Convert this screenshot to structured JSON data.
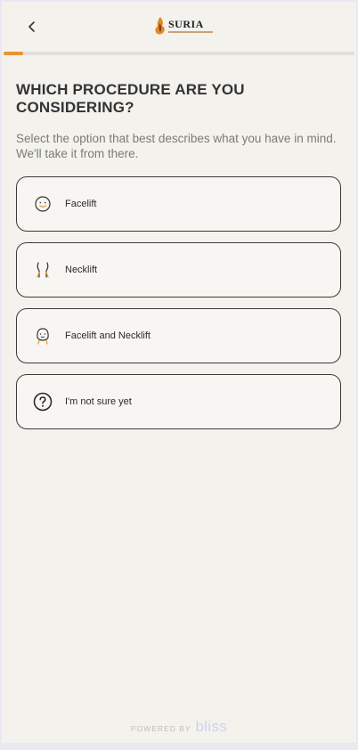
{
  "header": {
    "back_icon": "chevron-left-icon",
    "logo_text": "SURIA",
    "logo_icon": "suria-flame-logo-icon"
  },
  "progress": {
    "fraction": 0.055,
    "color": "#e8942f"
  },
  "question": {
    "title": "WHICH PROCEDURE ARE YOU CONSIDERING?",
    "subtitle": "Select the option that best describes what you have in mind. We'll take it from there."
  },
  "options": [
    {
      "label": "Facelift",
      "icon": "face-icon"
    },
    {
      "label": "Necklift",
      "icon": "neck-icon"
    },
    {
      "label": "Facelift and Necklift",
      "icon": "face-neck-icon"
    },
    {
      "label": "I'm not sure yet",
      "icon": "question-icon"
    }
  ],
  "footer": {
    "powered_by": "POWERED BY",
    "brand": "bliss"
  },
  "colors": {
    "accent": "#e8942f",
    "background": "#f3f2ed",
    "border": "#3a3a3a"
  }
}
